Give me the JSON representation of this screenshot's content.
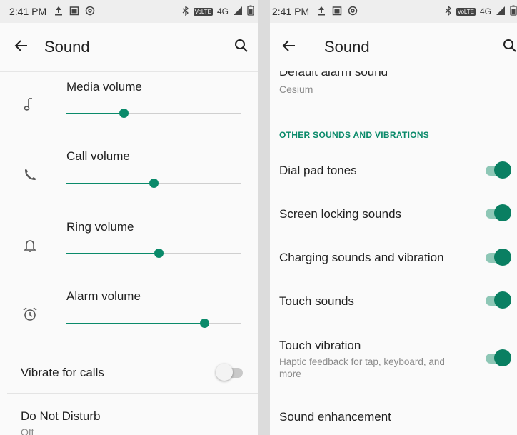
{
  "left": {
    "status_time": "2:41 PM",
    "network": "4G",
    "volte": "VoLTE",
    "title": "Sound",
    "sliders": [
      {
        "label": "Media volume",
        "icon": "music-note-icon",
        "level": 0.33
      },
      {
        "label": "Call volume",
        "icon": "phone-icon",
        "level": 0.5
      },
      {
        "label": "Ring volume",
        "icon": "bell-icon",
        "level": 0.53
      },
      {
        "label": "Alarm volume",
        "icon": "alarm-clock-icon",
        "level": 0.79
      }
    ],
    "vibrate_label": "Vibrate for calls",
    "vibrate_on": false,
    "dnd_label": "Do Not Disturb",
    "dnd_value": "Off"
  },
  "right": {
    "status_time": "2:41 PM",
    "network": "4G",
    "volte": "VoLTE",
    "title": "Sound",
    "alarm_sound_label": "Default alarm sound",
    "alarm_sound_value": "Cesium",
    "section_header": "OTHER SOUNDS AND VIBRATIONS",
    "toggles": [
      {
        "label": "Dial pad tones",
        "on": true
      },
      {
        "label": "Screen locking sounds",
        "on": true
      },
      {
        "label": "Charging sounds and vibration",
        "on": true
      },
      {
        "label": "Touch sounds",
        "on": true
      },
      {
        "label": "Touch vibration",
        "sub": "Haptic feedback for tap, keyboard, and more",
        "on": true
      }
    ],
    "enhancement_label": "Sound enhancement"
  },
  "colors": {
    "accent": "#0a8a6a",
    "toggle_on_knob": "#0a7f62",
    "toggle_on_track": "#8ec7b6"
  }
}
